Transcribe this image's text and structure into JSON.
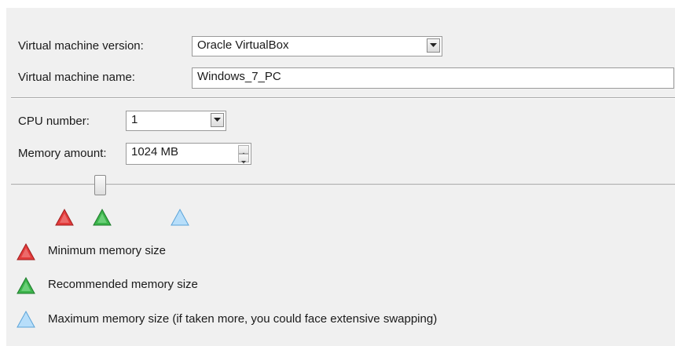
{
  "form": {
    "vm_version_label": "Virtual machine version:",
    "vm_version_value": "Oracle VirtualBox",
    "vm_name_label": "Virtual machine name:",
    "vm_name_value": "Windows_7_PC",
    "cpu_label": "CPU number:",
    "cpu_value": "1",
    "memory_label": "Memory amount:",
    "memory_value": "1024 MB"
  },
  "memory_slider": {
    "level": "unlabeled; thumb near the low end of the track"
  },
  "legend": {
    "min": {
      "label": "Minimum memory size",
      "color": "#e23b3b",
      "icon": "red-triangle-icon"
    },
    "recommended": {
      "label": "Recommended memory size",
      "color": "#3cb44b",
      "icon": "green-triangle-icon"
    },
    "max": {
      "label": "Maximum memory size (if taken more, you could face extensive swapping)",
      "color": "#8ec9ef",
      "icon": "blue-triangle-icon"
    }
  },
  "colors": {
    "panel_bg": "#f0f0f0",
    "red": "#e23b3b",
    "green": "#3cb44b",
    "blue": "#8ec9ef"
  }
}
